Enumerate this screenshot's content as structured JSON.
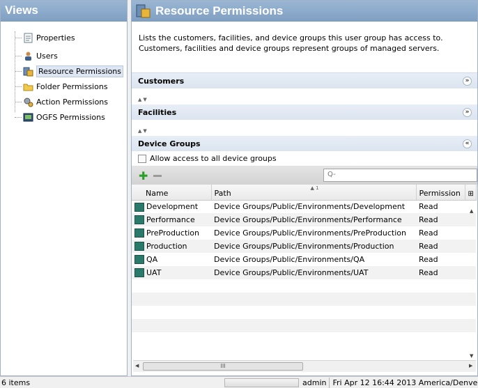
{
  "views": {
    "title": "Views",
    "items": [
      {
        "label": "Properties",
        "icon": "document-icon"
      },
      {
        "label": "Users",
        "icon": "user-icon"
      },
      {
        "label": "Resource Permissions",
        "icon": "resource-icon"
      },
      {
        "label": "Folder Permissions",
        "icon": "folder-icon"
      },
      {
        "label": "Action Permissions",
        "icon": "gears-icon"
      },
      {
        "label": "OGFS Permissions",
        "icon": "terminal-icon"
      }
    ],
    "selected": "Resource Permissions"
  },
  "main": {
    "title": "Resource Permissions",
    "description": "Lists the customers, facilities, and device groups this user group has access to. Customers, facilities and device groups represent groups of managed servers.",
    "sections": {
      "customers": "Customers",
      "facilities": "Facilities",
      "device_groups": "Device Groups"
    },
    "allow_all_label": "Allow access to all device groups",
    "search_placeholder": "Q-",
    "columns": {
      "name": "Name",
      "path": "Path",
      "permission": "Permission",
      "sort_index": "1"
    },
    "rows": [
      {
        "name": "Development",
        "path": "Device Groups/Public/Environments/Development",
        "permission": "Read"
      },
      {
        "name": "Performance",
        "path": "Device Groups/Public/Environments/Performance",
        "permission": "Read"
      },
      {
        "name": "PreProduction",
        "path": "Device Groups/Public/Environments/PreProduction",
        "permission": "Read"
      },
      {
        "name": "Production",
        "path": "Device Groups/Public/Environments/Production",
        "permission": "Read"
      },
      {
        "name": "QA",
        "path": "Device Groups/Public/Environments/QA",
        "permission": "Read"
      },
      {
        "name": "UAT",
        "path": "Device Groups/Public/Environments/UAT",
        "permission": "Read"
      }
    ],
    "hscroll_grip": "III"
  },
  "status": {
    "items_count": "6 items",
    "user": "admin",
    "datetime": "Fri Apr 12 16:44 2013 America/Denve"
  },
  "colors": {
    "header_blue": "#8aa9cb",
    "accent_green": "#2aa02a"
  }
}
